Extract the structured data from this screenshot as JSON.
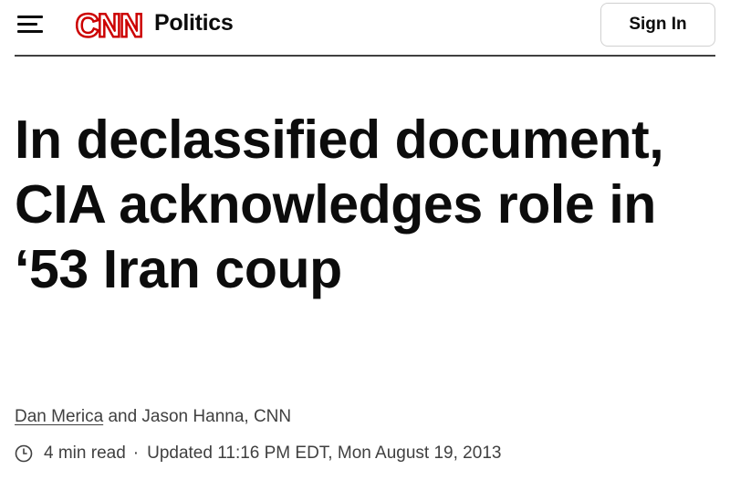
{
  "header": {
    "menu_icon": "hamburger-menu-icon",
    "logo_text": "CNN",
    "brand_color": "#cc0000",
    "section": "Politics",
    "sign_in_label": "Sign In"
  },
  "article": {
    "headline": "In declassified document, CIA acknowledges role in ‘53 Iran coup",
    "byline": {
      "author_1": "Dan Merica",
      "joiner": "and",
      "author_2": "Jason Hanna, CNN"
    },
    "meta": {
      "clock_icon": "clock-icon",
      "read_time": "4 min read",
      "separator": "·",
      "updated": "Updated 11:16 PM EDT, Mon August 19, 2013"
    }
  }
}
